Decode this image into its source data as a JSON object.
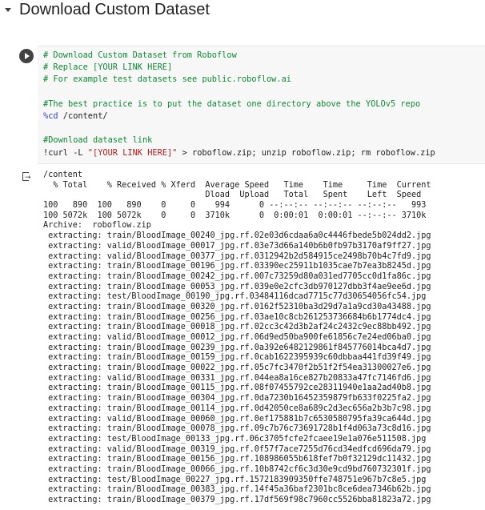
{
  "section": {
    "title": "Download Custom Dataset"
  },
  "code": {
    "lines": [
      [
        {
          "t": "# Download Custom Dataset from Roboflow",
          "c": "cm"
        }
      ],
      [
        {
          "t": "# Replace [YOUR LINK HERE]",
          "c": "cm"
        }
      ],
      [
        {
          "t": "# For example test datasets see public.roboflow.ai",
          "c": "cm"
        }
      ],
      [],
      [
        {
          "t": "#The best practice is to put the dataset one directory above the YOLOv5 repo",
          "c": "cm"
        }
      ],
      [
        {
          "t": "%cd",
          "c": "magic"
        },
        {
          "t": " /content/",
          "c": ""
        }
      ],
      [],
      [
        {
          "t": "#Download dataset link",
          "c": "cm"
        }
      ],
      [
        {
          "t": "!curl -L ",
          "c": ""
        },
        {
          "t": "\"[YOUR LINK HERE]\"",
          "c": "str"
        },
        {
          "t": " > roboflow.zip; unzip roboflow.zip; rm roboflow.zip",
          "c": ""
        }
      ]
    ]
  },
  "output": {
    "lines": [
      "/content",
      "  % Total    % Received % Xferd  Average Speed   Time    Time     Time  Current",
      "                                 Dload  Upload   Total   Spent    Left  Speed",
      "100   890  100   890    0     0    994      0 --:--:-- --:--:-- --:--:--   993",
      "100 5072k  100 5072k    0     0  3710k      0  0:00:01  0:00:01 --:--:-- 3710k",
      "Archive:  roboflow.zip",
      " extracting: train/BloodImage_00240_jpg.rf.02e03d6cdaa6a0c4446fbede5b024dd2.jpg",
      " extracting: valid/BloodImage_00017_jpg.rf.03e73d66a140b6b0fb97b3170af9ff27.jpg",
      " extracting: valid/BloodImage_00377_jpg.rf.0312942b2d584915ce2498b70b4c7fd9.jpg",
      " extracting: train/BloodImage_00196_jpg.rf.03390ec25911b1035cae7b7ea3b8245d.jpg",
      " extracting: train/BloodImage_00242_jpg.rf.007c73259d80a031ed7705cc0d1fa86c.jpg",
      " extracting: train/BloodImage_00053_jpg.rf.039e0e2cfc3db970127dbb3f4ae9ee6d.jpg",
      " extracting: test/BloodImage_00190_jpg.rf.03484116dcad7715c77d30654056fc54.jpg",
      " extracting: train/BloodImage_00320_jpg.rf.0162f52310ba3d29d7a1a9cd30a43488.jpg",
      " extracting: train/BloodImage_00256_jpg.rf.03ae10c8cb261253736684b6b1774dc4.jpg",
      " extracting: train/BloodImage_00018_jpg.rf.02cc3c42d3b2af24c2432c9ec88bb492.jpg",
      " extracting: valid/BloodImage_00012_jpg.rf.06d9ed50ba900fe61856c7e24ed06ba0.jpg",
      " extracting: train/BloodImage_00239_jpg.rf.0a392e6482129861f845776014bca4d7.jpg",
      " extracting: train/BloodImage_00159_jpg.rf.0cab1622395939c60dbbaa441fd39f49.jpg",
      " extracting: train/BloodImage_00022_jpg.rf.05c7fc3470f2b51f2f54ea31300027e6.jpg",
      " extracting: valid/BloodImage_00331_jpg.rf.044ea8a16ce827b20833a47fc7146fd6.jpg",
      " extracting: train/BloodImage_00115_jpg.rf.08f07455792ce28311940e1aa2ad40b8.jpg",
      " extracting: train/BloodImage_00304_jpg.rf.0da7230b16452359879fb633f0225fa2.jpg",
      " extracting: train/BloodImage_00114_jpg.rf.0d42050ce8a689c2d3ec656a2b3b7c98.jpg",
      " extracting: valid/BloodImage_00060_jpg.rf.0ef175881b7c6530580795fa39ca644d.jpg",
      " extracting: train/BloodImage_00078_jpg.rf.09c7b76c73691728b1f4d063a73c8d16.jpg",
      " extracting: test/BloodImage_00133_jpg.rf.06c3705fcfe2fcaee19e1a076e511508.jpg",
      " extracting: valid/BloodImage_00319_jpg.rf.0f57f7ace7255d76cd34edfcd696da79.jpg",
      " extracting: train/BloodImage_00156_jpg.rf.108986055b618fef7b0f32129dc11432.jpg",
      " extracting: train/BloodImage_00066_jpg.rf.10b8742cf6c3d30e9cd9bd760732301f.jpg",
      " extracting: test/BloodImage_00227_jpg.rf.1572183909350ffe748751e967b7c8e5.jpg",
      " extracting: train/BloodImage_00383_jpg.rf.14f45a36baf2301bc8ce6dea7346b62b.jpg",
      " extracting: train/BloodImage_00379_jpg.rf.17df569f98c7960cc5526bba81823a72.jpg"
    ]
  }
}
